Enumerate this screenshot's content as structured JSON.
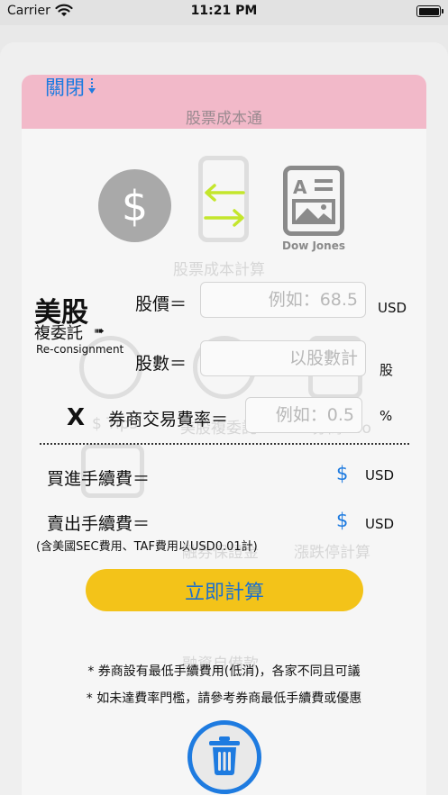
{
  "status": {
    "carrier": "Carrier",
    "time": "11:21 PM"
  },
  "background": {
    "title": "股票成本通",
    "ghosts": [
      "股票成本計算",
      "$ Tips",
      "美股複委託",
      "券商info",
      "融券保證金",
      "漲跌停計算",
      "融資自備款"
    ]
  },
  "header": {
    "close_label": "關閉"
  },
  "icons": {
    "doc_label": "Dow Jones"
  },
  "section": {
    "title": "美股",
    "subtitle": "複委託",
    "arrow": "➠",
    "english": "Re-consignment"
  },
  "form": {
    "price_label": "股價＝",
    "price_placeholder": "例如：68.5",
    "price_unit": "USD",
    "shares_label": "股數＝",
    "shares_placeholder": "以股數計",
    "shares_unit": "股",
    "multiply": "X",
    "rate_label": "券商交易費率＝",
    "rate_placeholder": "例如：0.5",
    "rate_unit": "%"
  },
  "results": {
    "buy_label": "買進手續費＝",
    "buy_symbol": "$",
    "buy_unit": "USD",
    "sell_label": "賣出手續費＝",
    "sell_symbol": "$",
    "sell_unit": "USD",
    "note": "(含美國SEC費用、TAF費用以USD0.01計)"
  },
  "action": {
    "calc_label": "立即計算"
  },
  "footnotes": [
    "* 券商設有最低手續費用(低消)，各家不同且可議",
    "* 如未達費率門檻，請參考券商最低手續費或優惠"
  ],
  "colors": {
    "accent": "#1e7be0",
    "button": "#f3c319",
    "pink": "#f2b9c9"
  }
}
